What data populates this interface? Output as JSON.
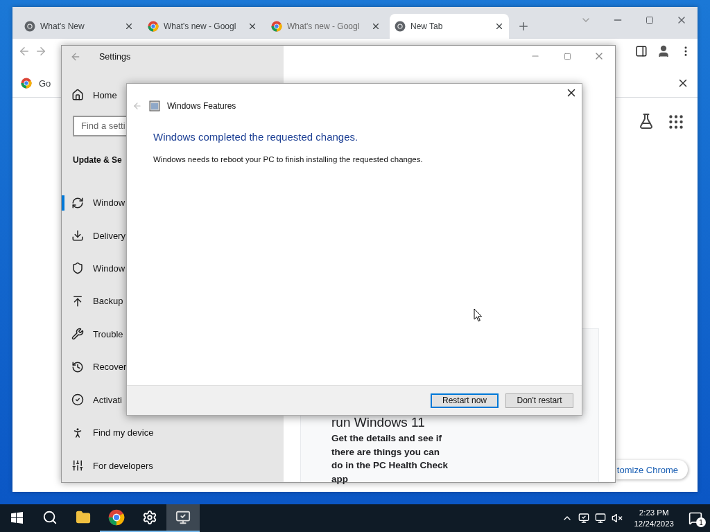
{
  "browser": {
    "tabs": [
      {
        "title": "What's New",
        "kind": "mono",
        "selected": false
      },
      {
        "title": "What's new - Googl",
        "kind": "color",
        "selected": false
      },
      {
        "title": "What's new - Googl",
        "kind": "color",
        "selected": false
      },
      {
        "title": "New Tab",
        "kind": "mono",
        "selected": true
      }
    ],
    "bookmark": "Go",
    "promo": {
      "heading": "run Windows 11",
      "body": "Get the details and see if there are things you can do in the PC Health Check app"
    },
    "customize_button": "tomize Chrome"
  },
  "settings": {
    "title": "Settings",
    "home": "Home",
    "search_placeholder": "Find a setti",
    "section": "Update & Se",
    "items": [
      {
        "label": "Window",
        "kind": "sync",
        "selected": true
      },
      {
        "label": "Delivery",
        "kind": "delivery",
        "selected": false
      },
      {
        "label": "Window",
        "kind": "shield",
        "selected": false
      },
      {
        "label": "Backup",
        "kind": "backup",
        "selected": false
      },
      {
        "label": "Trouble",
        "kind": "wrench",
        "selected": false
      },
      {
        "label": "Recover",
        "kind": "recovery",
        "selected": false
      },
      {
        "label": "Activati",
        "kind": "activation",
        "selected": false
      },
      {
        "label": "Find my device",
        "kind": "device",
        "selected": false
      },
      {
        "label": "For developers",
        "kind": "developers",
        "selected": false
      }
    ]
  },
  "dialog": {
    "title": "Windows Features",
    "heading": "Windows completed the requested changes.",
    "message": "Windows needs to reboot your PC to finish installing the requested changes.",
    "buttons": [
      {
        "label": "Restart now",
        "selected": true
      },
      {
        "label": "Don't restart",
        "selected": false
      }
    ]
  },
  "taskbar": {
    "apps": [
      {
        "kind": "start",
        "running": false,
        "active": false
      },
      {
        "kind": "search",
        "running": false,
        "active": false
      },
      {
        "kind": "explorer",
        "running": false,
        "active": false
      },
      {
        "kind": "chrome",
        "running": true,
        "active": false
      },
      {
        "kind": "settings",
        "running": true,
        "active": false
      },
      {
        "kind": "features",
        "running": true,
        "active": true
      }
    ],
    "time": "2:23 PM",
    "date": "12/24/2023",
    "notification_count": "1"
  }
}
